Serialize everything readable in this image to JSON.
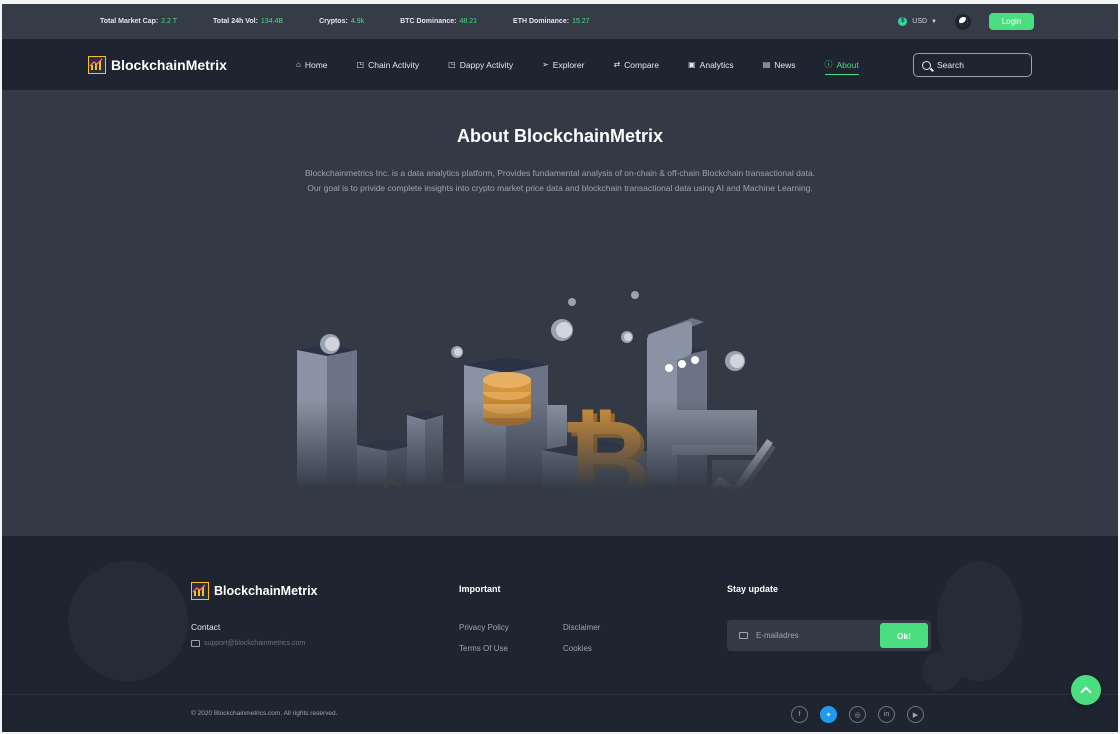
{
  "ticker": {
    "stats": [
      {
        "label": "Total Market Cap:",
        "value": "2.2 T"
      },
      {
        "label": "Total 24h Vol:",
        "value": "134.4B"
      },
      {
        "label": "Cryptos:",
        "value": "4.9k"
      },
      {
        "label": "BTC Dominance:",
        "value": "48.21"
      },
      {
        "label": "ETH Dominance:",
        "value": "15.27"
      }
    ],
    "currency": "USD",
    "login_label": "Login"
  },
  "nav": {
    "brand": "BlockchainMetrix",
    "items": [
      {
        "label": "Home",
        "icon": "home-icon"
      },
      {
        "label": "Chain Activity",
        "icon": "chart-box-icon"
      },
      {
        "label": "Dappy Activity",
        "icon": "chart-box-icon"
      },
      {
        "label": "Explorer",
        "icon": "send-icon"
      },
      {
        "label": "Compare",
        "icon": "swap-icon"
      },
      {
        "label": "Analytics",
        "icon": "analytics-icon"
      },
      {
        "label": "News",
        "icon": "news-icon"
      },
      {
        "label": "About",
        "icon": "info-icon",
        "active": true
      }
    ],
    "search_placeholder": "Search"
  },
  "hero": {
    "title": "About BlockchainMetrix",
    "description": "Blockchainmetrics Inc. is a data analytics platform, Provides fundamental analysis of on-chain & off-chain Blockchain transactional data. Our goal is to privide complete insights into crypto market price data and blockchain transactional data using AI and Machine Learning."
  },
  "footer": {
    "brand": "BlockchainMetrix",
    "contact_label": "Contact",
    "email": "support@blockchainmetrics.com",
    "important_label": "Important",
    "links": [
      "Privacy Policy",
      "Disclaimer",
      "Terms Of Use",
      "Cookies"
    ],
    "stay_label": "Stay update",
    "email_placeholder": "E-mailadres",
    "ok_label": "Ok!",
    "copyright": "© 2020 Blockchainmetrics.com. All rights reserved.",
    "socials": [
      "facebook-icon",
      "twitter-icon",
      "instagram-icon",
      "linkedin-icon",
      "youtube-icon"
    ]
  },
  "colors": {
    "accent": "#4ade80",
    "background": "#333a46",
    "navbar": "#1e2430",
    "footer": "#1f2530",
    "bitcoin": "#d4943a"
  }
}
